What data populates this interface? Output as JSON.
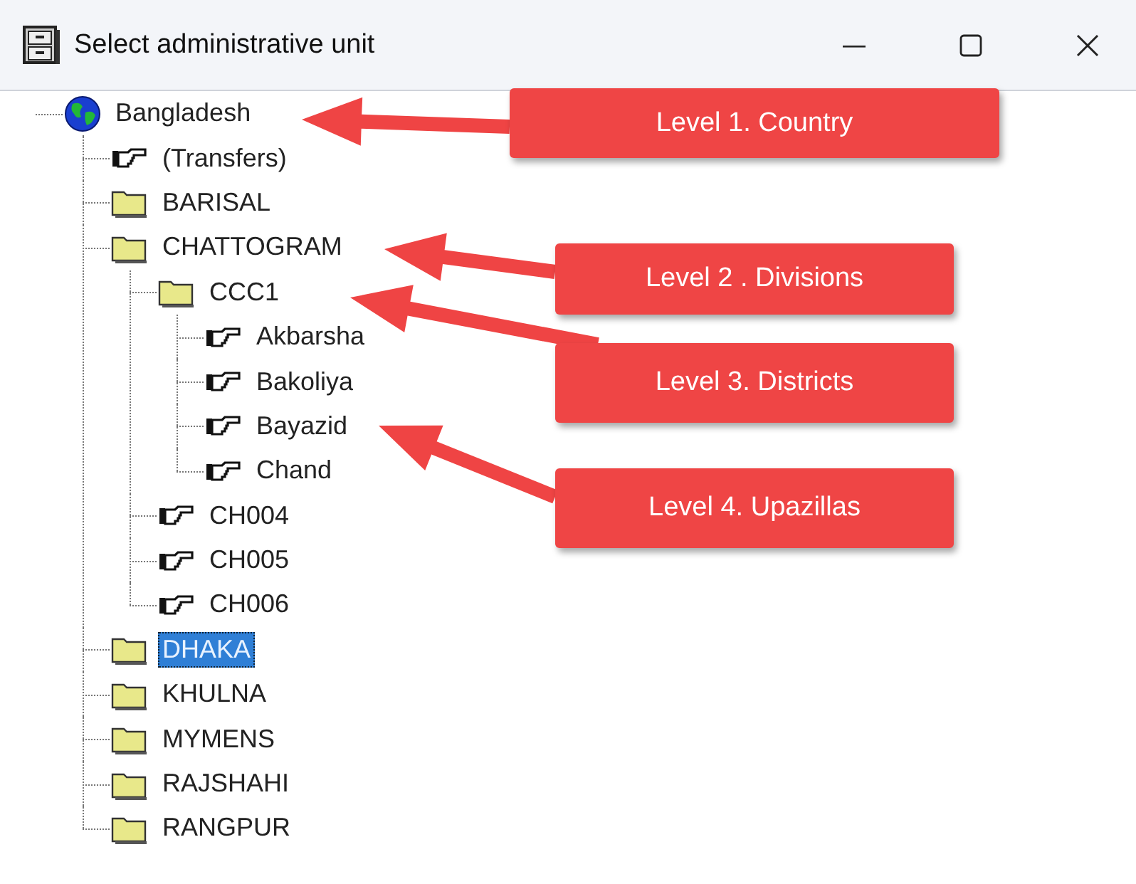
{
  "window": {
    "title": "Select administrative unit"
  },
  "tree": [
    {
      "label": "Bangladesh",
      "kind": "globe",
      "selected": false,
      "children": [
        {
          "label": "(Transfers)",
          "kind": "pointer",
          "selected": false
        },
        {
          "label": "BARISAL",
          "kind": "folder",
          "selected": false
        },
        {
          "label": "CHATTOGRAM",
          "kind": "folder",
          "selected": false,
          "children": [
            {
              "label": "CCC1",
              "kind": "folder",
              "selected": false,
              "children": [
                {
                  "label": "Akbarsha",
                  "kind": "pointer",
                  "selected": false
                },
                {
                  "label": "Bakoliya",
                  "kind": "pointer",
                  "selected": false
                },
                {
                  "label": "Bayazid",
                  "kind": "pointer",
                  "selected": false
                },
                {
                  "label": "Chand",
                  "kind": "pointer",
                  "selected": false
                }
              ]
            },
            {
              "label": "CH004",
              "kind": "pointer",
              "selected": false
            },
            {
              "label": "CH005",
              "kind": "pointer",
              "selected": false
            },
            {
              "label": "CH006",
              "kind": "pointer",
              "selected": false
            }
          ]
        },
        {
          "label": "DHAKA",
          "kind": "folder",
          "selected": true
        },
        {
          "label": "KHULNA",
          "kind": "folder",
          "selected": false
        },
        {
          "label": "MYMENS",
          "kind": "folder",
          "selected": false
        },
        {
          "label": "RAJSHAHI",
          "kind": "folder",
          "selected": false
        },
        {
          "label": "RANGPUR",
          "kind": "folder",
          "selected": false
        }
      ]
    }
  ],
  "annotations": [
    {
      "text": "Level 1. Country"
    },
    {
      "text": "Level 2 . Divisions"
    },
    {
      "text": "Level 3. Districts"
    },
    {
      "text": "Level 4. Upazillas"
    }
  ]
}
